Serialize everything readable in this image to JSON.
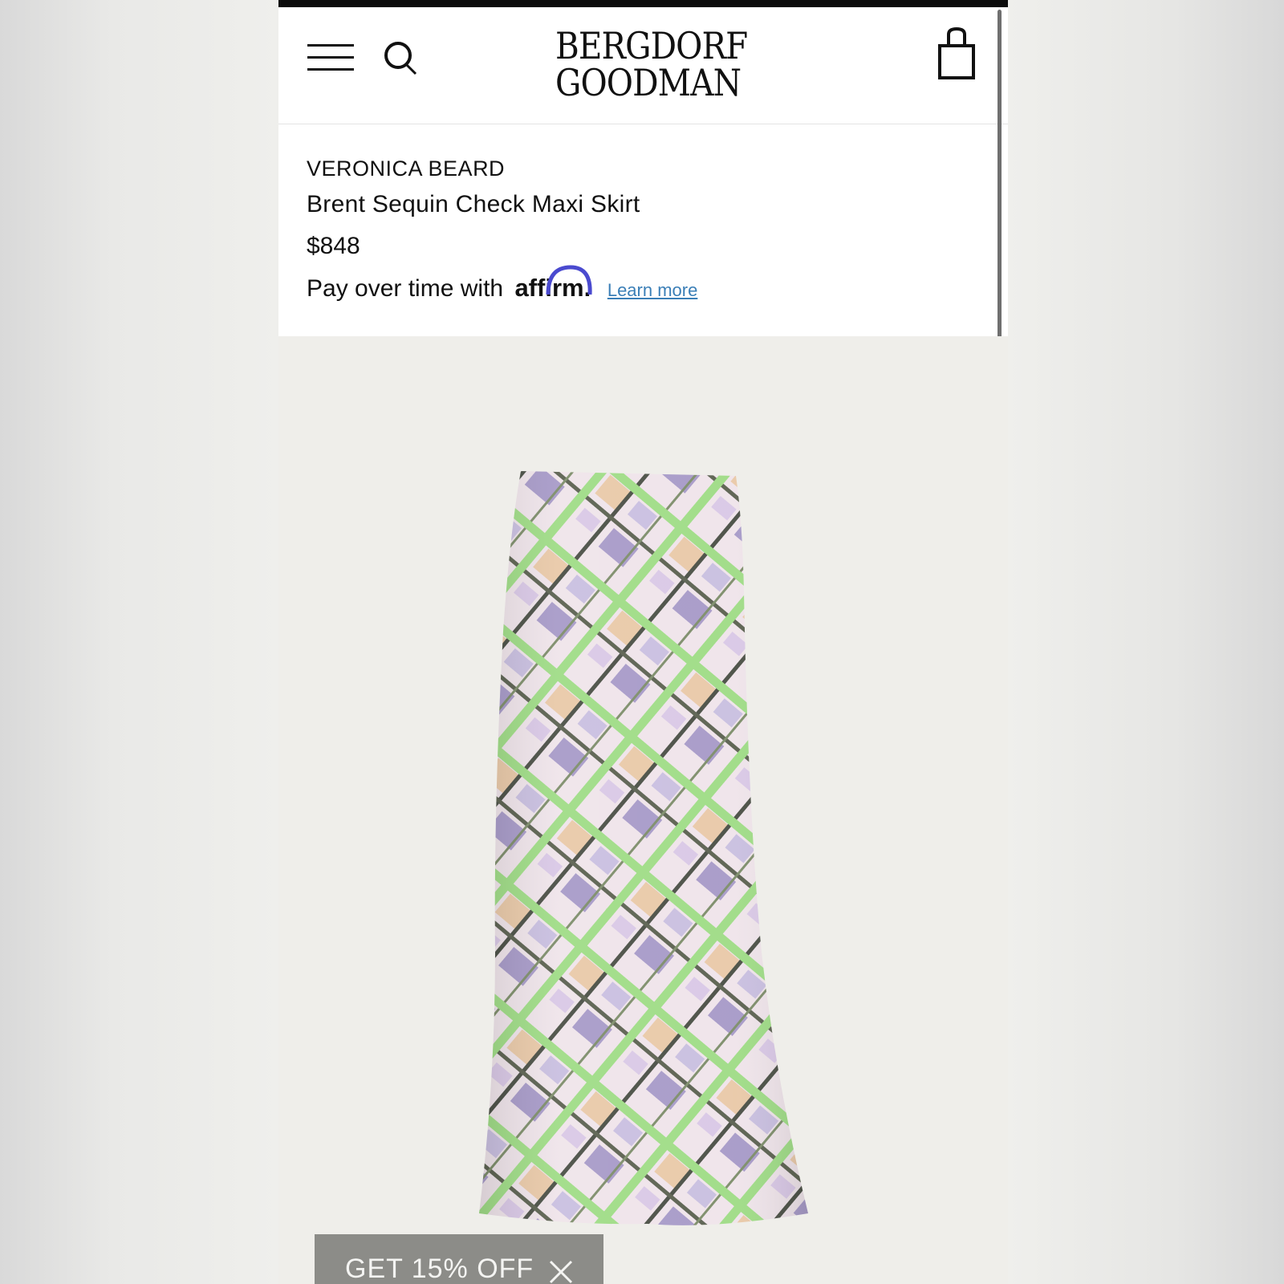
{
  "header": {
    "logo_line1": "BERGDORF",
    "logo_line2": "GOODMAN",
    "menu_icon": "hamburger-menu-icon",
    "search_icon": "search-icon",
    "bag_icon": "shopping-bag-icon"
  },
  "product": {
    "brand": "VERONICA BEARD",
    "name": "Brent Sequin Check Maxi Skirt",
    "price": "$848",
    "financing": {
      "prefix": "Pay over time with",
      "provider": "affirm",
      "suffix": ".",
      "link_label": "Learn more"
    },
    "image_alt": "Green, lavender and peach sequin diamond check maxi skirt"
  },
  "promo": {
    "label": "GET 15% OFF",
    "close_icon": "close-icon"
  },
  "colors": {
    "link": "#3b7fb7",
    "affirm_arc": "#4a4acf",
    "promo_bg": "#8c8c88",
    "skirt_green": "#9fdc86",
    "skirt_lavender": "#a79ac8",
    "skirt_peach": "#e9c9a8"
  }
}
